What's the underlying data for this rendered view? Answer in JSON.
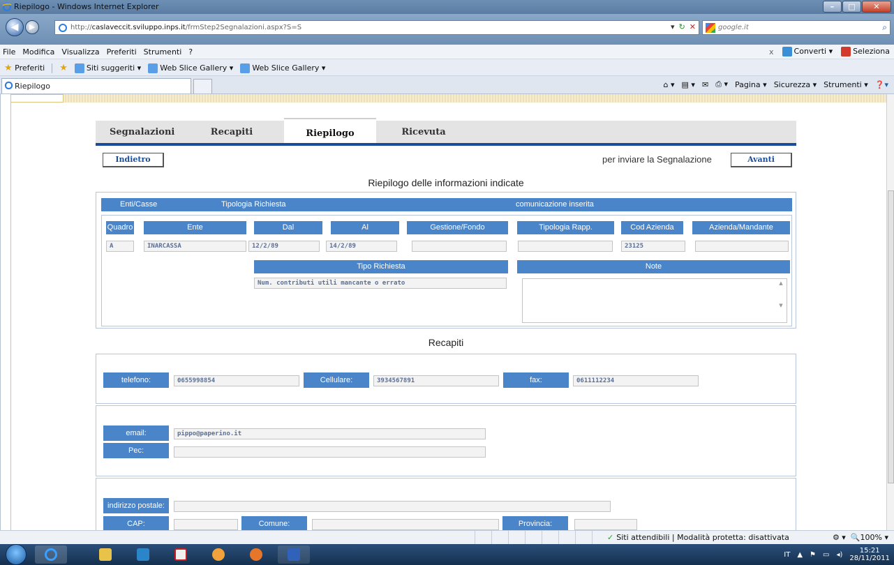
{
  "window": {
    "title": "Riepilogo - Windows Internet Explorer"
  },
  "address": {
    "url_prefix": "http://",
    "url_host": "caslaveccit.sviluppo.inps.it",
    "url_path": "/frmStep2Segnalazioni.aspx?S=S",
    "search_placeholder": "google.it"
  },
  "menu": {
    "items": [
      "File",
      "Modifica",
      "Visualizza",
      "Preferiti",
      "Strumenti",
      "?"
    ],
    "convert": "Converti",
    "select": "Seleziona"
  },
  "favorites": {
    "label": "Preferiti",
    "items": [
      "Siti suggeriti",
      "Web Slice Gallery",
      "Web Slice Gallery"
    ]
  },
  "tabs": {
    "current": "Riepilogo"
  },
  "commandbar": {
    "page": "Pagina",
    "security": "Sicurezza",
    "tools": "Strumenti"
  },
  "app": {
    "tabs": [
      "Segnalazioni",
      "Recapiti",
      "Riepilogo",
      "Ricevuta"
    ],
    "active_tab": "Riepilogo",
    "back_button": "Indietro",
    "send_label": "per inviare la Segnalazione",
    "next_button": "Avanti",
    "summary_title": "Riepilogo delle informazioni indicate",
    "band": {
      "col1": "Enti/Casse",
      "col2": "Tipologia Richiesta",
      "col3": "comunicazione inserita"
    },
    "headers": [
      "Quadro",
      "Ente",
      "Dal",
      "Al",
      "Gestione/Fondo",
      "Tipologia Rapp.",
      "Cod Azienda",
      "Azienda/Mandante"
    ],
    "row": {
      "quadro": "A",
      "ente": "INARCASSA",
      "dal": "12/2/89",
      "al": "14/2/89",
      "gestione": "",
      "tipologia": "",
      "cod_azienda": "23125",
      "azienda": ""
    },
    "tipo_richiesta_header": "Tipo Richiesta",
    "tipo_richiesta_value": "Num. contributi utili mancante o errato",
    "note_header": "Note",
    "recapiti_title": "Recapiti",
    "contacts": {
      "telefono_label": "telefono:",
      "telefono": "0655998854",
      "cellulare_label": "Cellulare:",
      "cellulare": "3934567891",
      "fax_label": "fax:",
      "fax": "0611112234",
      "email_label": "email:",
      "email": "pippo@paperino.it",
      "pec_label": "Pec:",
      "pec": "",
      "indirizzo_label": "indirizzo postale:",
      "indirizzo": "",
      "cap_label": "CAP:",
      "comune_label": "Comune:",
      "provincia_label": "Provincia:"
    }
  },
  "status": {
    "zone": "Siti attendibili | Modalità protetta: disattivata",
    "zoom": "100%"
  },
  "tray": {
    "lang": "IT",
    "time": "15:21",
    "date": "28/11/2011"
  },
  "colors": {
    "accent_blue": "#4a84c9",
    "tab_underline": "#1b4c9a",
    "field_text": "#5a6f96"
  }
}
